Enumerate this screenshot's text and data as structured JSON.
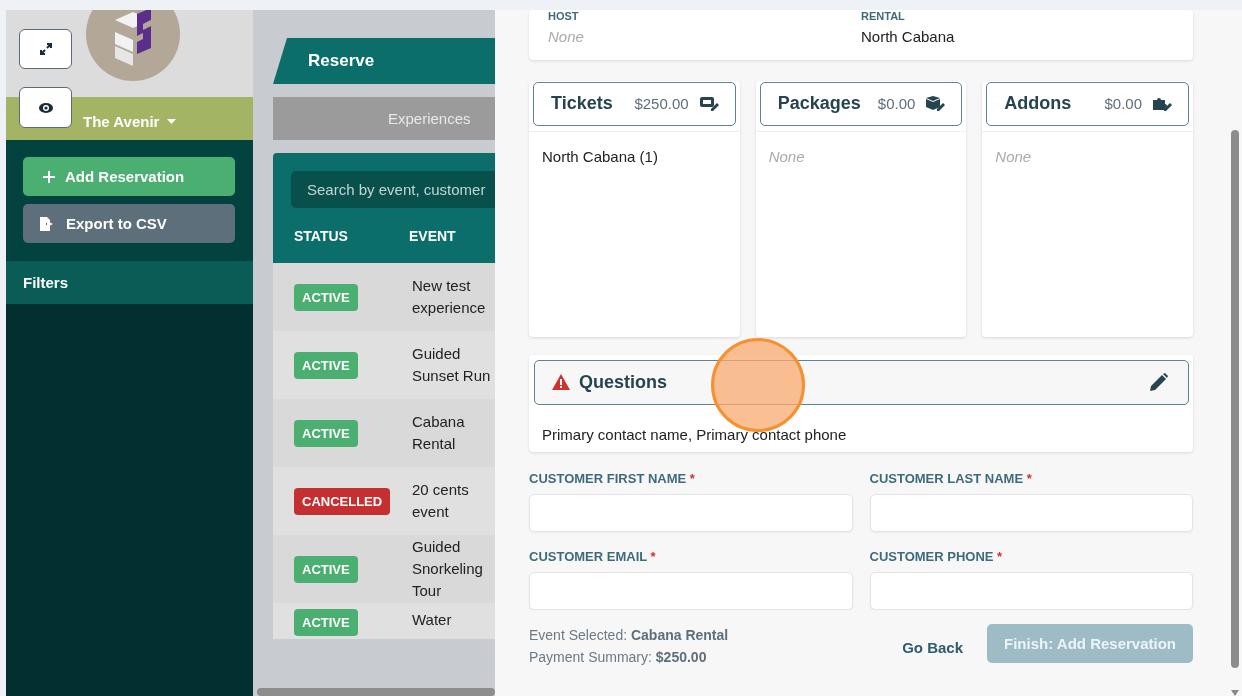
{
  "sidebar": {
    "venue": "The Avenir",
    "actions": [
      {
        "kind": "add",
        "label": "Add Reservation"
      },
      {
        "kind": "export",
        "label": "Export to CSV"
      }
    ],
    "filters": "Filters"
  },
  "reservations": {
    "tab": "Reserve",
    "subtab": "Experiences",
    "search": {
      "placeholder": "Search by event, customer"
    },
    "columns": [
      "STATUS",
      "EVENT"
    ],
    "rows": [
      {
        "status": {
          "kind": "active",
          "label": "ACTIVE"
        },
        "event": "New test experience"
      },
      {
        "status": {
          "kind": "active",
          "label": "ACTIVE"
        },
        "event": "Guided Sunset Run"
      },
      {
        "status": {
          "kind": "active",
          "label": "ACTIVE"
        },
        "event": "Cabana Rental"
      },
      {
        "status": {
          "kind": "cancelled",
          "label": "CANCELLED"
        },
        "event": "20 cents event"
      },
      {
        "status": {
          "kind": "active",
          "label": "ACTIVE"
        },
        "event": "Guided Snorkeling Tour"
      },
      {
        "status": {
          "kind": "active",
          "label": "ACTIVE"
        },
        "event": "Water"
      }
    ]
  },
  "modal": {
    "summary": [
      {
        "label": "HOST",
        "value": "None",
        "empty": true
      },
      {
        "label": "RENTAL",
        "value": "North Cabana",
        "empty": false
      }
    ],
    "sections": [
      {
        "kind": "tickets",
        "title": "Tickets",
        "amount": "$250.00",
        "items": [
          {
            "text": "North Cabana (1)",
            "empty": false
          }
        ]
      },
      {
        "kind": "packages",
        "title": "Packages",
        "amount": "$0.00",
        "items": [
          {
            "text": "None",
            "empty": true
          }
        ]
      },
      {
        "kind": "addons",
        "title": "Addons",
        "amount": "$0.00",
        "items": [
          {
            "text": "None",
            "empty": true
          }
        ]
      }
    ],
    "questions": {
      "title": "Questions",
      "warning": true,
      "text": "Primary contact name, Primary contact phone"
    },
    "fields": [
      {
        "label": "CUSTOMER FIRST NAME",
        "required": "*"
      },
      {
        "label": "CUSTOMER LAST NAME",
        "required": "*"
      },
      {
        "label": "CUSTOMER EMAIL",
        "required": "*"
      },
      {
        "label": "CUSTOMER PHONE",
        "required": "*"
      }
    ],
    "footer": {
      "event_label": "Event Selected:",
      "event_value": "Cabana Rental",
      "payment_label": "Payment Summary:",
      "payment_value": "$250.00"
    },
    "buttons": [
      {
        "kind": "link",
        "label": "Go Back",
        "disabled": false
      },
      {
        "kind": "primary",
        "label": "Finish: Add Reservation",
        "disabled": true
      }
    ]
  }
}
